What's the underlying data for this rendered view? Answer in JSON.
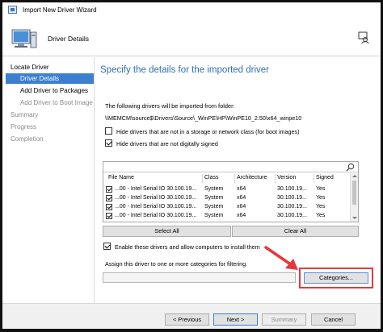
{
  "window": {
    "title": "Import New Driver Wizard"
  },
  "header": {
    "page_name": "Driver Details"
  },
  "nav": {
    "items": [
      {
        "label": "Locate Driver"
      },
      {
        "label": "Driver Details"
      },
      {
        "label": "Add Driver to Packages"
      },
      {
        "label": "Add Driver to Boot Image"
      },
      {
        "label": "Summary"
      },
      {
        "label": "Progress"
      },
      {
        "label": "Completion"
      }
    ],
    "selected": "Driver Details"
  },
  "main": {
    "heading": "Specify the details for the imported driver",
    "following_text": "The following drivers will be imported from folder:",
    "folder_path": "\\\\MEMCM\\source$\\Drivers\\Source\\_WinPE\\HP\\WinPE10_2.50\\x64_winpe10",
    "hide_storage_label": "Hide drivers that are not in a storage or network class (for boot images)",
    "hide_storage_checked": false,
    "hide_unsigned_label": "Hide drivers that are not digitally signed",
    "hide_unsigned_checked": true,
    "search_placeholder": "",
    "driver_table": {
      "headers": [
        "File Name",
        "Class",
        "Architecture",
        "Version",
        "Signed"
      ],
      "rows": [
        {
          "checked": true,
          "file_name": "...00 - Intel Serial IO 30.100.19...",
          "class": "System",
          "architecture": "x64",
          "version": "30.100.19...",
          "signed": "Yes"
        },
        {
          "checked": true,
          "file_name": "...00 - Intel Serial IO 30.100.19...",
          "class": "System",
          "architecture": "x64",
          "version": "30.100.19...",
          "signed": "Yes"
        },
        {
          "checked": true,
          "file_name": "...00 - Intel Serial IO 30.100.19...",
          "class": "System",
          "architecture": "x64",
          "version": "30.100.19...",
          "signed": "Yes"
        },
        {
          "checked": true,
          "file_name": "...00 - Intel Serial IO 30.100.19...",
          "class": "System",
          "architecture": "x64",
          "version": "30.100.19...",
          "signed": "Yes"
        }
      ]
    },
    "select_all_label": "Select All",
    "clear_all_label": "Clear All",
    "enable_label": "Enable these drivers and allow computers to install them",
    "enable_checked": true,
    "assign_text": "Assign this driver to one or more categories for filtering.",
    "category_value": "",
    "categories_label": "Categories..."
  },
  "footer": {
    "previous_label": "< Previous",
    "next_label": "Next >",
    "summary_label": "Summary",
    "cancel_label": "Cancel"
  },
  "colors": {
    "accent": "#3c7fcf",
    "heading": "#2e6fb7",
    "highlight": "#e8373a"
  }
}
